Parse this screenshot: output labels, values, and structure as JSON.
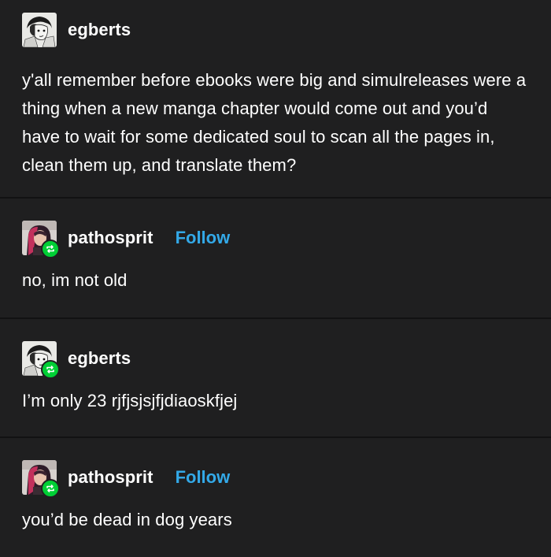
{
  "posts": [
    {
      "username": "egberts",
      "avatar_icon": "manga-sketch-avatar",
      "is_reblog": false,
      "show_follow": false,
      "body": "y'all remember before ebooks were big and simulreleases were a thing when a new manga chapter would come out and you’d have to wait for some dedicated soul to scan all the pages in, clean them up, and translate them?"
    },
    {
      "username": "pathosprit",
      "avatar_icon": "portrait-photo-avatar",
      "is_reblog": true,
      "show_follow": true,
      "follow_label": "Follow",
      "body": "no, im not old"
    },
    {
      "username": "egberts",
      "avatar_icon": "manga-sketch-avatar",
      "is_reblog": true,
      "show_follow": false,
      "body": "I’m only 23 rjfjsjsjfjdiaoskfjej"
    },
    {
      "username": "pathosprit",
      "avatar_icon": "portrait-photo-avatar",
      "is_reblog": true,
      "show_follow": true,
      "follow_label": "Follow",
      "body": "you’d be dead in dog years"
    }
  ],
  "colors": {
    "background": "#1f1f20",
    "divider": "#121213",
    "text": "#ffffff",
    "follow": "#33a9e8",
    "reblog_badge": "#00cf35"
  }
}
